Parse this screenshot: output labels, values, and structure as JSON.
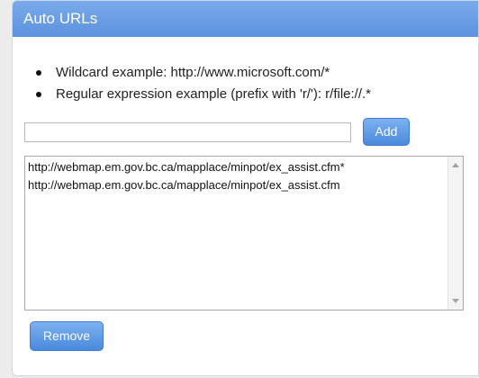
{
  "panel": {
    "title": "Auto URLs"
  },
  "examples": [
    "Wildcard example: http://www.microsoft.com/*",
    "Regular expression example (prefix with 'r/'): r/file://.*"
  ],
  "url_input": {
    "value": "",
    "placeholder": ""
  },
  "buttons": {
    "add_label": "Add",
    "remove_label": "Remove"
  },
  "url_list": {
    "items": [
      "http://webmap.em.gov.bc.ca/mapplace/minpot/ex_assist.cfm*",
      "http://webmap.em.gov.bc.ca/mapplace/minpot/ex_assist.cfm"
    ]
  },
  "colors": {
    "header_bg": "#6b9fe6",
    "button_bg": "#5b96e4",
    "page_bg": "#ececec"
  },
  "icons": {
    "scroll_up": "chevron-up-icon",
    "scroll_down": "chevron-down-icon"
  }
}
